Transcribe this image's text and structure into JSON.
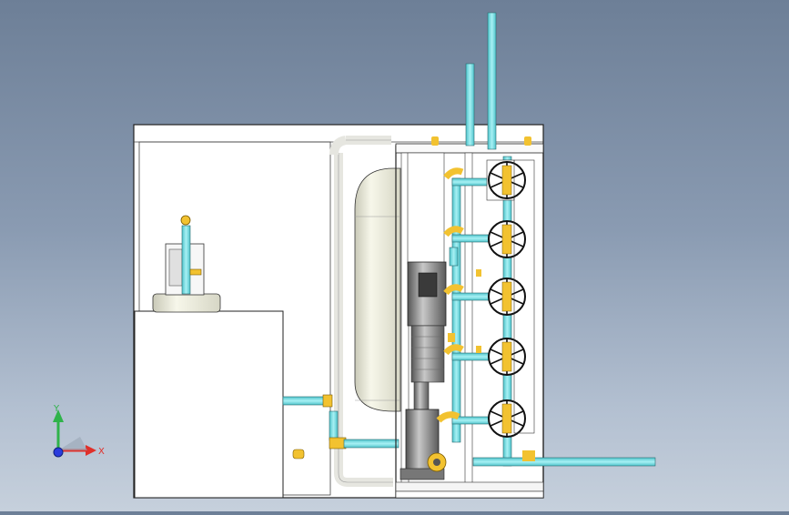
{
  "viewport": {
    "background_top": "#6d7f97",
    "background_bottom": "#c6d0dc",
    "model_colors": {
      "pipe": "#7fe3e8",
      "pipe_outline": "#2a6a6e",
      "fitting": "#f2c230",
      "fitting_dark": "#b88a10",
      "tank": "#f2f2e4",
      "frame": "#ffffff",
      "outline": "#202020",
      "pump_motor": "#8a8a8a"
    }
  },
  "triad": {
    "x_label": "X",
    "y_label": "Y",
    "x_color": "#e0302a",
    "y_color": "#2fb34a",
    "z_color": "#2a3cdd"
  },
  "icons": {
    "triad": "coordinate-triad-icon"
  }
}
